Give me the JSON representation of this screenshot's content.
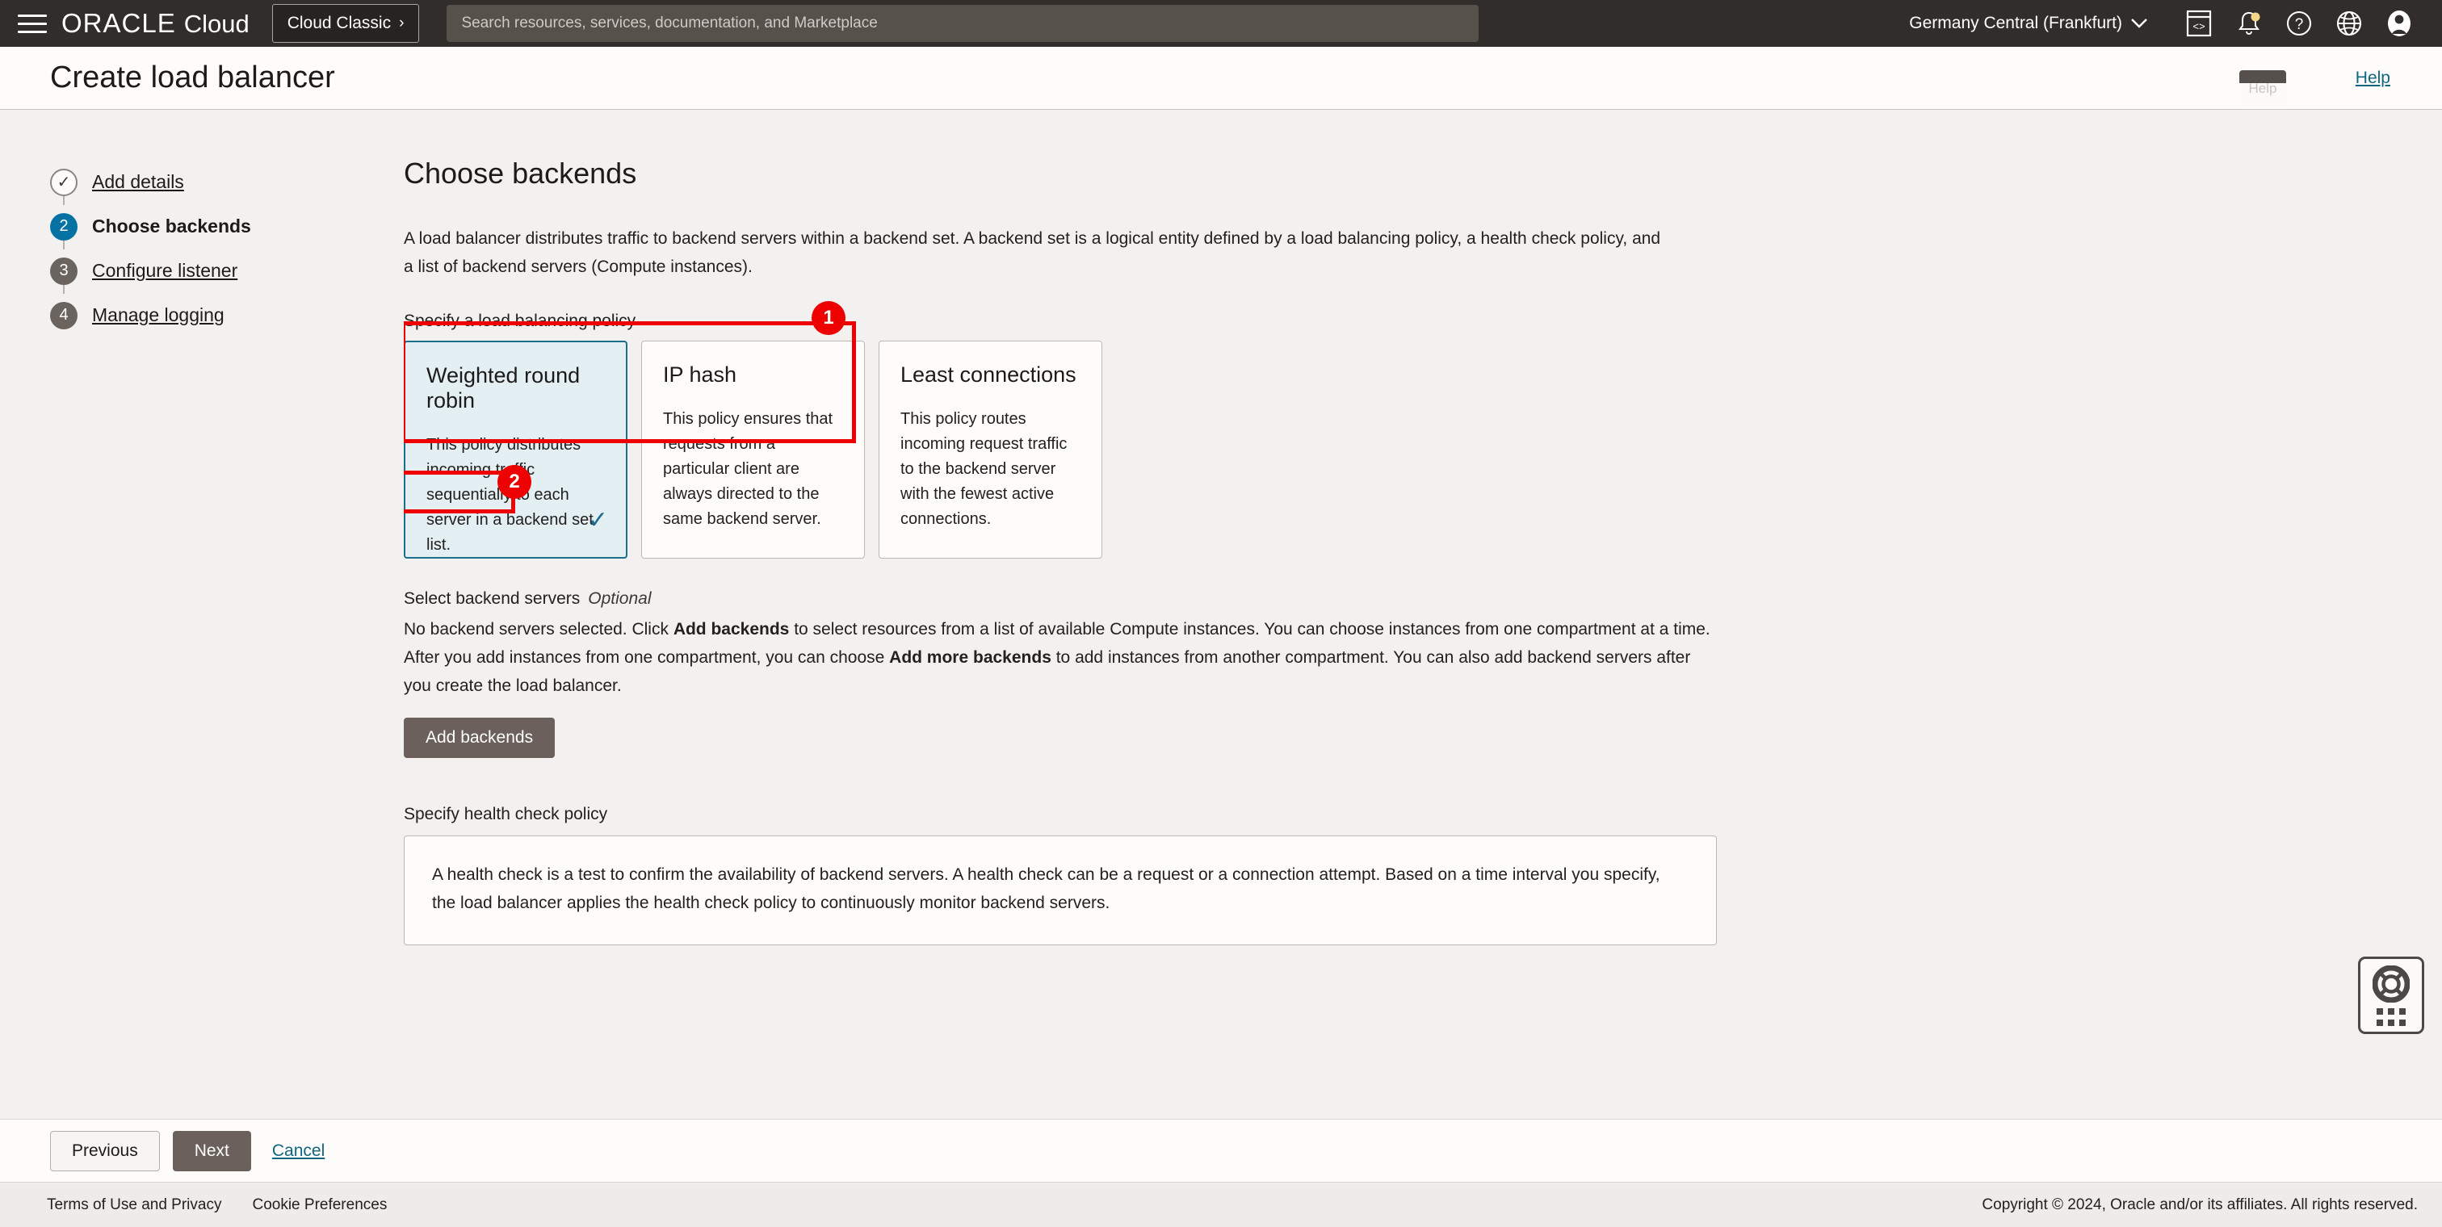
{
  "topnav": {
    "menu_icon": "hamburger-icon",
    "brand_oracle": "ORACLE",
    "brand_cloud": "Cloud",
    "classic_button": "Cloud Classic",
    "classic_chevron": "›",
    "search_placeholder": "Search resources, services, documentation, and Marketplace",
    "search_value": "",
    "region": "Germany Central (Frankfurt)",
    "region_chevron": "⌄",
    "icons": [
      "cloud-shell-icon",
      "notifications-bell-icon",
      "help-question-icon",
      "language-globe-icon",
      "user-profile-icon"
    ],
    "tooltip": "Help",
    "notification_dot_color": "#f3d58a"
  },
  "titlebar": {
    "title": "Create load balancer",
    "help_label": "Help",
    "help_color": "#12657f"
  },
  "sidebar": {
    "steps": [
      {
        "number": "✓",
        "label": "Add details",
        "state": "done"
      },
      {
        "number": "2",
        "label": "Choose backends",
        "state": "active"
      },
      {
        "number": "3",
        "label": "Configure listener",
        "state": "pending"
      },
      {
        "number": "4",
        "label": "Manage logging",
        "state": "pending"
      }
    ],
    "active_color": "#0672a4",
    "pending_color": "#6b635e"
  },
  "main": {
    "heading": "Choose backends",
    "intro": "A load balancer distributes traffic to backend servers within a backend set. A backend set is a logical entity defined by a load balancing policy, a health check policy, and a list of backend servers (Compute instances).",
    "policy_label": "Specify a load balancing policy",
    "policies": [
      {
        "title": "Weighted round robin",
        "desc": "This policy distributes incoming traffic sequentially to each server in a backend set list.",
        "selected": true,
        "check": "✓"
      },
      {
        "title": "IP hash",
        "desc": "This policy ensures that requests from a particular client are always directed to the same backend server.",
        "selected": false,
        "check": ""
      },
      {
        "title": "Least connections",
        "desc": "This policy routes incoming request traffic to the backend server with the fewest active connections.",
        "selected": false,
        "check": ""
      }
    ],
    "backend_label": "Select backend servers",
    "backend_optional": "Optional",
    "backend_text_1": "No backend servers selected. Click ",
    "backend_bold_1": "Add backends",
    "backend_text_2": " to select resources from a list of available Compute instances. You can choose instances from one compartment at a time. After you add instances from one compartment, you can choose ",
    "backend_bold_2": "Add more backends",
    "backend_text_3": " to add instances from another compartment. You can also add backend servers after you create the load balancer.",
    "add_backends_label": "Add backends",
    "health_label": "Specify health check policy",
    "health_text": "A health check is a test to confirm the availability of backend servers. A health check can be a request or a connection attempt. Based on a time interval you specify, the load balancer applies the health check policy to continuously monitor backend servers.",
    "selected_card_bg": "#e3eff3",
    "selected_card_border": "#1b6e8c"
  },
  "annotations": [
    {
      "number": "1",
      "target": "weighted-round-robin-card"
    },
    {
      "number": "2",
      "target": "add-backends-button"
    }
  ],
  "support_widget": {
    "icon": "lifesaver-icon",
    "grid": "app-grid-icon"
  },
  "actionbar": {
    "previous": "Previous",
    "next": "Next",
    "cancel": "Cancel"
  },
  "footer": {
    "terms": "Terms of Use and Privacy",
    "cookies": "Cookie Preferences",
    "copyright": "Copyright © 2024, Oracle and/or its affiliates. All rights reserved."
  }
}
